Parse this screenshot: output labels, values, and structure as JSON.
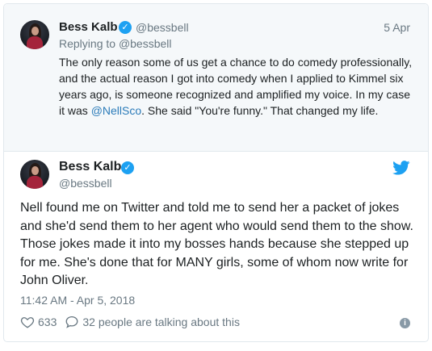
{
  "parent_tweet": {
    "name": "Bess Kalb",
    "handle": "@bessbell",
    "date": "5 Apr",
    "reply_label": "Replying to",
    "reply_to": "@bessbell",
    "text_before_link": "The only reason some of us get a chance to do comedy professionally, and the actual reason I got into comedy when I applied to Kimmel six years ago, is someone recognized and amplified my voice. In my case it was ",
    "link": "@NellSco",
    "text_after_link": ". She said \"You're funny.\" That changed my life."
  },
  "main_tweet": {
    "name": "Bess Kalb",
    "handle": "@bessbell",
    "text": "Nell found me on Twitter and told me to send her a packet of jokes and she'd send them to her agent who would send them to the show. Those jokes made it into my bosses hands because she stepped up for me. She's done that for MANY girls, some of whom now write for John Oliver.",
    "timestamp": "11:42 AM - Apr 5, 2018",
    "likes": "633",
    "conversation": "32 people are talking about this"
  },
  "icons": {
    "verified": "verified-badge-icon",
    "bird": "twitter-bird-icon",
    "heart": "heart-icon",
    "reply": "speech-bubble-icon",
    "info": "info-icon"
  },
  "colors": {
    "accent": "#1da1f2",
    "link": "#2b7bb9",
    "muted": "#697882",
    "parent_bg": "#f5f8fa"
  }
}
